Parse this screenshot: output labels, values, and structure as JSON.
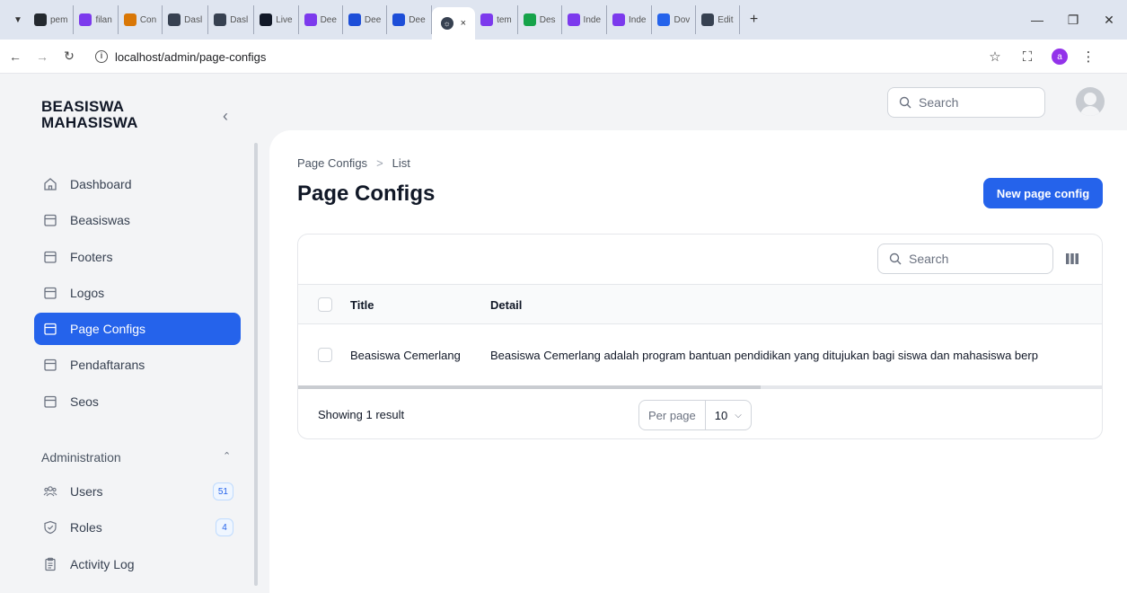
{
  "browser": {
    "tabs": [
      {
        "label": "pem",
        "icon": "github-icon",
        "color": "#24292f"
      },
      {
        "label": "filan",
        "icon": "yandex-icon",
        "color": "#7c3aed"
      },
      {
        "label": "Con",
        "icon": "filament-icon",
        "color": "#d97706"
      },
      {
        "label": "Dasl",
        "icon": "globe-icon",
        "color": "#374151"
      },
      {
        "label": "Dasl",
        "icon": "globe-icon",
        "color": "#374151"
      },
      {
        "label": "Live",
        "icon": "live-icon",
        "color": "#111827"
      },
      {
        "label": "Dee",
        "icon": "yandex-icon",
        "color": "#7c3aed"
      },
      {
        "label": "Dee",
        "icon": "deepl-icon",
        "color": "#1d4ed8"
      },
      {
        "label": "Dee",
        "icon": "deepl-icon",
        "color": "#1d4ed8"
      }
    ],
    "active_tab_close": "×",
    "tabs_after": [
      {
        "label": "tem",
        "icon": "yandex-icon",
        "color": "#7c3aed"
      },
      {
        "label": "Des",
        "icon": "design-icon",
        "color": "#16a34a"
      },
      {
        "label": "Inde",
        "icon": "bootstrap-icon",
        "color": "#7c3aed"
      },
      {
        "label": "Inde",
        "icon": "bootstrap-icon",
        "color": "#7c3aed"
      },
      {
        "label": "Dov",
        "icon": "download-icon",
        "color": "#2563eb"
      },
      {
        "label": "Edit",
        "icon": "globe-icon",
        "color": "#374151"
      }
    ],
    "url": "localhost/admin/page-configs",
    "profile_initial": "a"
  },
  "sidebar": {
    "brand_line1": "BEASISWA",
    "brand_line2": "MAHASISWA",
    "items": [
      {
        "label": "Dashboard",
        "icon": "home-icon"
      },
      {
        "label": "Beasiswas",
        "icon": "folder-icon"
      },
      {
        "label": "Footers",
        "icon": "folder-icon"
      },
      {
        "label": "Logos",
        "icon": "folder-icon"
      },
      {
        "label": "Page Configs",
        "icon": "folder-icon",
        "active": true
      },
      {
        "label": "Pendaftarans",
        "icon": "folder-icon"
      },
      {
        "label": "Seos",
        "icon": "folder-icon"
      }
    ],
    "group_label": "Administration",
    "admin_items": [
      {
        "label": "Users",
        "icon": "users-icon",
        "badge": "51"
      },
      {
        "label": "Roles",
        "icon": "shield-check-icon",
        "badge": "4"
      },
      {
        "label": "Activity Log",
        "icon": "clipboard-icon"
      }
    ]
  },
  "topbar": {
    "search_placeholder": "Search"
  },
  "page": {
    "breadcrumb_1": "Page Configs",
    "breadcrumb_sep": ">",
    "breadcrumb_2": "List",
    "title": "Page Configs",
    "new_button": "New page config"
  },
  "table": {
    "search_placeholder": "Search",
    "columns": [
      "Title",
      "Detail"
    ],
    "rows": [
      {
        "title": "Beasiswa Cemerlang",
        "detail": "Beasiswa Cemerlang adalah program bantuan pendidikan yang ditujukan bagi siswa dan mahasiswa berp"
      }
    ],
    "footer_text": "Showing 1 result",
    "per_page_label": "Per page",
    "per_page_value": "10"
  },
  "colors": {
    "accent": "#2563eb",
    "sidebar_bg": "#f3f4f6"
  }
}
